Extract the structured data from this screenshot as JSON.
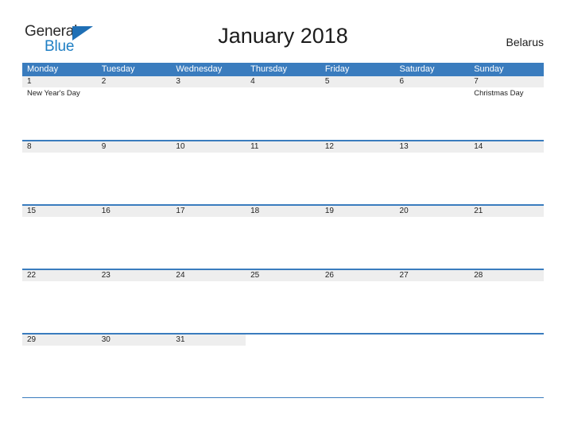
{
  "brand": {
    "name_primary": "General",
    "name_secondary": "Blue",
    "flag_icon": "triangle-flag-icon",
    "primary_color": "#2b2b2b",
    "secondary_color": "#1f7fc4"
  },
  "header": {
    "title": "January 2018",
    "country": "Belarus"
  },
  "theme": {
    "header_blue": "#3a7cbe",
    "daynum_band": "#eeeeee",
    "rule_blue": "#3a7cbe",
    "text": "#222222"
  },
  "calendar": {
    "month": "January",
    "year": "2018",
    "weekday_headers": [
      "Monday",
      "Tuesday",
      "Wednesday",
      "Thursday",
      "Friday",
      "Saturday",
      "Sunday"
    ],
    "weeks": [
      {
        "days": [
          {
            "number": "1",
            "events": [
              "New Year's Day"
            ]
          },
          {
            "number": "2",
            "events": []
          },
          {
            "number": "3",
            "events": []
          },
          {
            "number": "4",
            "events": []
          },
          {
            "number": "5",
            "events": []
          },
          {
            "number": "6",
            "events": []
          },
          {
            "number": "7",
            "events": [
              "Christmas Day"
            ]
          }
        ]
      },
      {
        "days": [
          {
            "number": "8",
            "events": []
          },
          {
            "number": "9",
            "events": []
          },
          {
            "number": "10",
            "events": []
          },
          {
            "number": "11",
            "events": []
          },
          {
            "number": "12",
            "events": []
          },
          {
            "number": "13",
            "events": []
          },
          {
            "number": "14",
            "events": []
          }
        ]
      },
      {
        "days": [
          {
            "number": "15",
            "events": []
          },
          {
            "number": "16",
            "events": []
          },
          {
            "number": "17",
            "events": []
          },
          {
            "number": "18",
            "events": []
          },
          {
            "number": "19",
            "events": []
          },
          {
            "number": "20",
            "events": []
          },
          {
            "number": "21",
            "events": []
          }
        ]
      },
      {
        "days": [
          {
            "number": "22",
            "events": []
          },
          {
            "number": "23",
            "events": []
          },
          {
            "number": "24",
            "events": []
          },
          {
            "number": "25",
            "events": []
          },
          {
            "number": "26",
            "events": []
          },
          {
            "number": "27",
            "events": []
          },
          {
            "number": "28",
            "events": []
          }
        ]
      },
      {
        "days": [
          {
            "number": "29",
            "events": []
          },
          {
            "number": "30",
            "events": []
          },
          {
            "number": "31",
            "events": []
          },
          {
            "number": "",
            "events": []
          },
          {
            "number": "",
            "events": []
          },
          {
            "number": "",
            "events": []
          },
          {
            "number": "",
            "events": []
          }
        ]
      }
    ]
  }
}
